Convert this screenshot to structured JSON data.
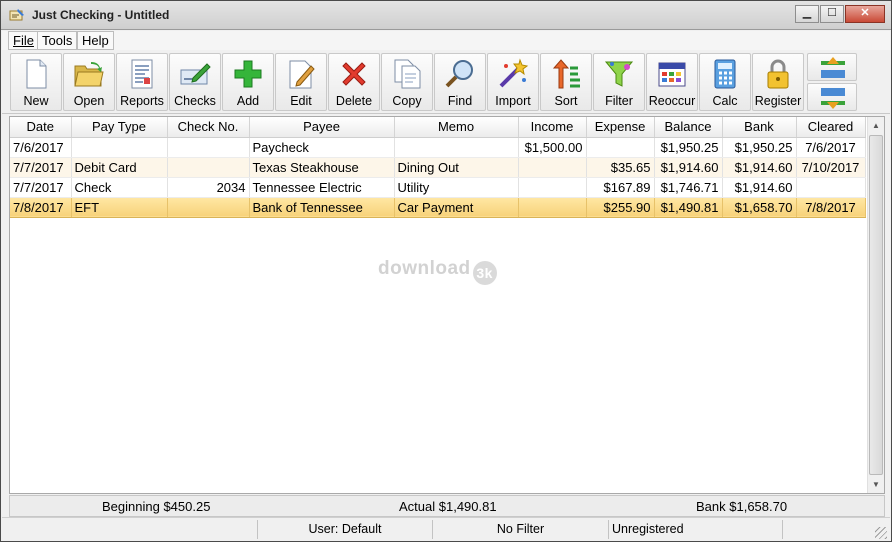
{
  "window": {
    "title": "Just Checking - Untitled",
    "controls": {
      "minimize": "▁",
      "maximize": "☐",
      "close": "✕"
    }
  },
  "menu": [
    {
      "label": "File",
      "accel": "F"
    },
    {
      "label": "Tools",
      "accel": "T"
    },
    {
      "label": "Help",
      "accel": "H"
    }
  ],
  "toolbar": [
    {
      "label": "New",
      "icon": "new-document-icon"
    },
    {
      "label": "Open",
      "icon": "open-folder-icon"
    },
    {
      "label": "Reports",
      "icon": "reports-icon"
    },
    {
      "label": "Checks",
      "icon": "checks-icon"
    },
    {
      "label": "Add",
      "icon": "add-icon"
    },
    {
      "label": "Edit",
      "icon": "edit-icon"
    },
    {
      "label": "Delete",
      "icon": "delete-icon"
    },
    {
      "label": "Copy",
      "icon": "copy-icon"
    },
    {
      "label": "Find",
      "icon": "find-icon"
    },
    {
      "label": "Import",
      "icon": "import-icon"
    },
    {
      "label": "Sort",
      "icon": "sort-icon"
    },
    {
      "label": "Filter",
      "icon": "filter-icon"
    },
    {
      "label": "Reoccur",
      "icon": "reoccur-calendar-icon"
    },
    {
      "label": "Calc",
      "icon": "calculator-icon"
    },
    {
      "label": "Register",
      "icon": "padlock-icon"
    }
  ],
  "move_buttons": [
    {
      "icon": "move-up-icon"
    },
    {
      "icon": "move-down-icon"
    }
  ],
  "register": {
    "columns": [
      "Date",
      "Pay Type",
      "Check No.",
      "Payee",
      "Memo",
      "Income",
      "Expense",
      "Balance",
      "Bank",
      "Cleared"
    ],
    "rows": [
      {
        "date": "7/6/2017",
        "pay_type": "",
        "check_no": "",
        "payee": "Paycheck",
        "memo": "",
        "income": "$1,500.00",
        "expense": "",
        "balance": "$1,950.25",
        "bank": "$1,950.25",
        "cleared": "7/6/2017",
        "state": "normal"
      },
      {
        "date": "7/7/2017",
        "pay_type": "Debit Card",
        "check_no": "",
        "payee": "Texas Steakhouse",
        "memo": "Dining Out",
        "income": "",
        "expense": "$35.65",
        "balance": "$1,914.60",
        "bank": "$1,914.60",
        "cleared": "7/10/2017",
        "state": "alt"
      },
      {
        "date": "7/7/2017",
        "pay_type": "Check",
        "check_no": "2034",
        "payee": "Tennessee Electric",
        "memo": "Utility",
        "income": "",
        "expense": "$167.89",
        "balance": "$1,746.71",
        "bank": "$1,914.60",
        "cleared": "",
        "state": "normal"
      },
      {
        "date": "7/8/2017",
        "pay_type": "EFT",
        "check_no": "",
        "payee": "Bank of Tennessee",
        "memo": "Car Payment",
        "income": "",
        "expense": "$255.90",
        "balance": "$1,490.81",
        "bank": "$1,658.70",
        "cleared": "7/8/2017",
        "state": "selected"
      }
    ],
    "watermark": {
      "text": "download",
      "badge": "3k"
    }
  },
  "totals": {
    "beginning": "Beginning $450.25",
    "actual": "Actual $1,490.81",
    "bank": "Bank $1,658.70"
  },
  "status": {
    "user": "User: Default",
    "filter": "No Filter",
    "registration": "Unregistered"
  },
  "colors": {
    "selected_row": "#f7d27a",
    "alt_row": "#fdf6e9",
    "close_button": "#c94a36"
  }
}
